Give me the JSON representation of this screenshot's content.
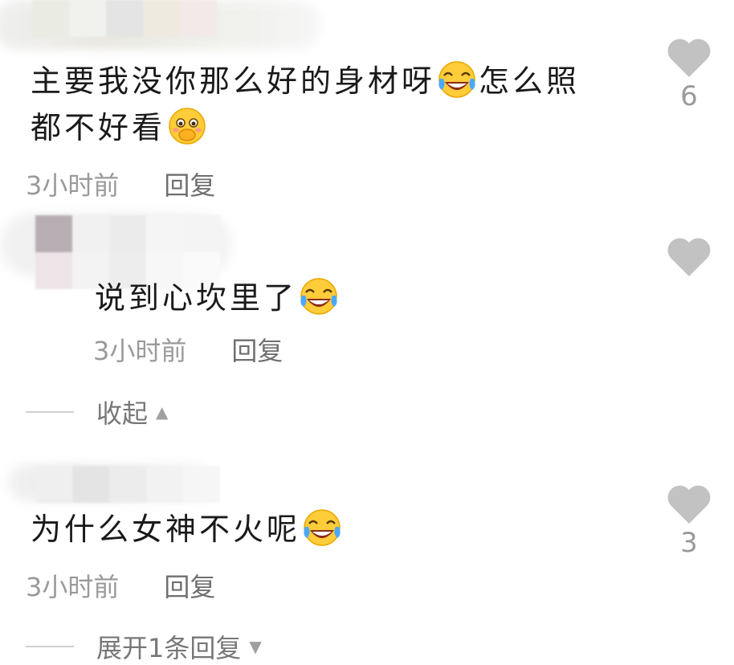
{
  "comments": [
    {
      "text_a": "主要我没你那么好的身材呀",
      "text_b": "怎么照",
      "text_c": "都不好看",
      "time": "3小时前",
      "reply_label": "回复",
      "likes": "6"
    },
    {
      "text_a": "说到心坎里了",
      "time": "3小时前",
      "reply_label": "回复"
    },
    {
      "text_a": "为什么女神不火呢",
      "time": "3小时前",
      "reply_label": "回复",
      "likes": "3"
    }
  ],
  "collapse_label": "收起",
  "expand_label": "展开1条回复",
  "icons": {
    "like": "heart-icon",
    "laugh": "tears-of-joy-emoji",
    "shy": "shy-face-emoji",
    "collapse": "triangle-up-icon",
    "expand": "triangle-down-icon"
  },
  "colors": {
    "heart": "#c2c2c2",
    "meta": "#9a9a9a",
    "text": "#1a1a1a"
  }
}
